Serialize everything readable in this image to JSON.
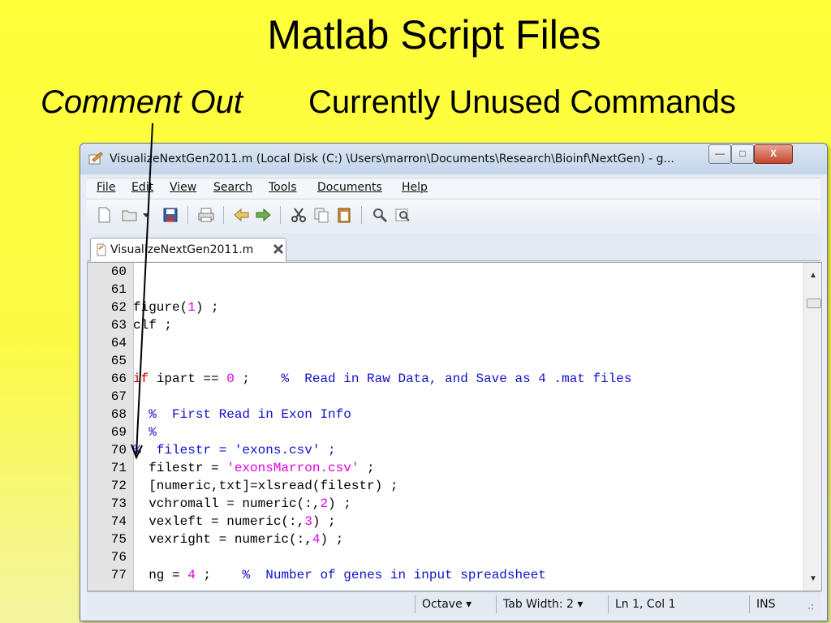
{
  "slide": {
    "title": "Matlab Script Files",
    "subtitle_italic": "Comment Out",
    "subtitle_rest": "Currently Unused Commands"
  },
  "window": {
    "title": "VisualizeNextGen2011.m (Local Disk (C:) \\Users\\marron\\Documents\\Research\\Bioinf\\NextGen) - g...",
    "min_label": "—",
    "max_label": "□",
    "close_label": "X"
  },
  "menu": [
    "File",
    "Edit",
    "View",
    "Search",
    "Tools",
    "Documents",
    "Help"
  ],
  "toolbar_icons": [
    "new-file-icon",
    "open-folder-icon",
    "dropdown-arrow-icon",
    "save-icon",
    "print-icon",
    "undo-icon",
    "redo-icon",
    "cut-icon",
    "copy-icon",
    "paste-icon",
    "find-icon",
    "find-replace-icon"
  ],
  "tab": {
    "label": "VisualizeNextGen2011.m"
  },
  "code": [
    {
      "n": "60",
      "segs": []
    },
    {
      "n": "61",
      "segs": []
    },
    {
      "n": "62",
      "segs": [
        {
          "t": "figure(",
          "c": ""
        },
        {
          "t": "1",
          "c": "num"
        },
        {
          "t": ") ;",
          "c": ""
        }
      ]
    },
    {
      "n": "63",
      "segs": [
        {
          "t": "clf ;",
          "c": ""
        }
      ]
    },
    {
      "n": "64",
      "segs": []
    },
    {
      "n": "65",
      "segs": []
    },
    {
      "n": "66",
      "segs": [
        {
          "t": "if",
          "c": "kw"
        },
        {
          "t": " ipart == ",
          "c": ""
        },
        {
          "t": "0",
          "c": "num"
        },
        {
          "t": " ;    ",
          "c": ""
        },
        {
          "t": "%  Read in Raw Data, and Save as 4 .mat files",
          "c": "cm"
        }
      ]
    },
    {
      "n": "67",
      "segs": []
    },
    {
      "n": "68",
      "segs": [
        {
          "t": "  %  First Read in Exon Info",
          "c": "cm"
        }
      ]
    },
    {
      "n": "69",
      "segs": [
        {
          "t": "  %",
          "c": "cm"
        }
      ]
    },
    {
      "n": "70",
      "segs": [
        {
          "t": "%  filestr = 'exons.csv' ;",
          "c": "cm"
        }
      ]
    },
    {
      "n": "71",
      "segs": [
        {
          "t": "  filestr = ",
          "c": ""
        },
        {
          "t": "'exonsMarron.csv'",
          "c": "str"
        },
        {
          "t": " ;",
          "c": ""
        }
      ]
    },
    {
      "n": "72",
      "segs": [
        {
          "t": "  [numeric,txt]=xlsread(filestr) ;",
          "c": ""
        }
      ]
    },
    {
      "n": "73",
      "segs": [
        {
          "t": "  vchromall = numeric(:,",
          "c": ""
        },
        {
          "t": "2",
          "c": "num"
        },
        {
          "t": ") ;",
          "c": ""
        }
      ]
    },
    {
      "n": "74",
      "segs": [
        {
          "t": "  vexleft = numeric(:,",
          "c": ""
        },
        {
          "t": "3",
          "c": "num"
        },
        {
          "t": ") ;",
          "c": ""
        }
      ]
    },
    {
      "n": "75",
      "segs": [
        {
          "t": "  vexright = numeric(:,",
          "c": ""
        },
        {
          "t": "4",
          "c": "num"
        },
        {
          "t": ") ;",
          "c": ""
        }
      ]
    },
    {
      "n": "76",
      "segs": []
    },
    {
      "n": "77",
      "segs": [
        {
          "t": "  ng = ",
          "c": ""
        },
        {
          "t": "4",
          "c": "num"
        },
        {
          "t": " ;    ",
          "c": ""
        },
        {
          "t": "%  Number of genes in input spreadsheet",
          "c": "cm"
        }
      ]
    }
  ],
  "status": {
    "language": "Octave ▾",
    "tab_width": "Tab Width:  2 ▾",
    "position": "Ln 1, Col 1",
    "mode": "INS"
  },
  "colors": {
    "comment": "#1010c8",
    "number": "#e000e0",
    "keyword": "#c00000",
    "background": "#ffff3a"
  }
}
